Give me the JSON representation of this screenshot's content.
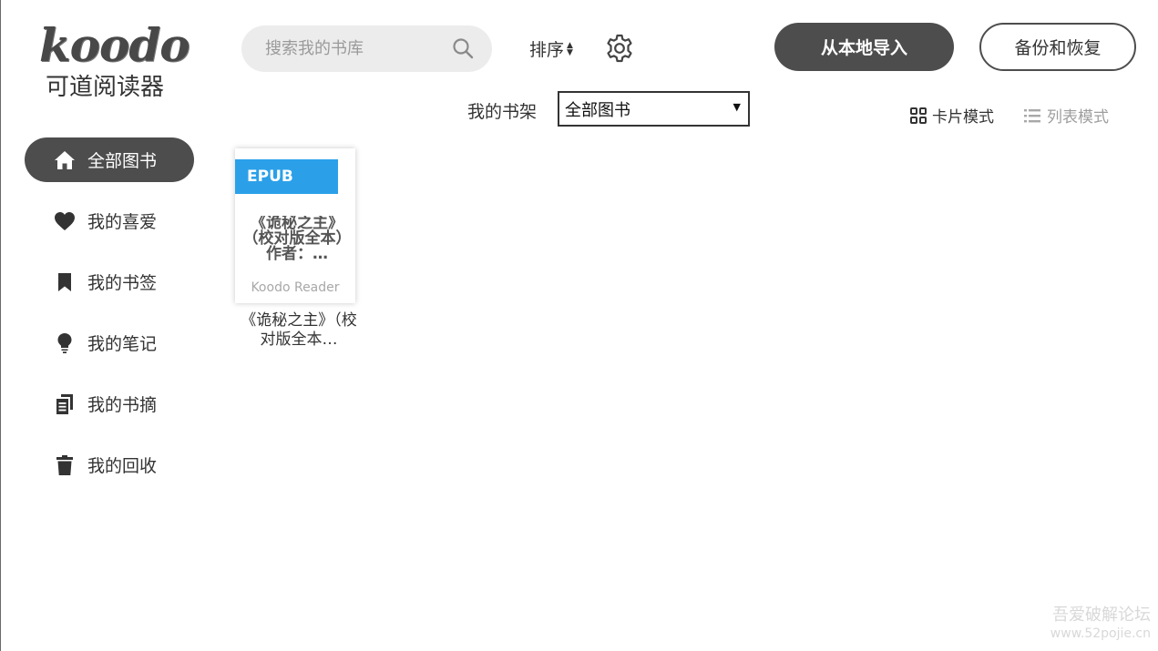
{
  "logo": {
    "wordmark": "koodo",
    "subtitle": "可道阅读器"
  },
  "sidebar": {
    "items": [
      {
        "label": "全部图书",
        "icon": "home-icon",
        "active": true
      },
      {
        "label": "我的喜爱",
        "icon": "heart-icon"
      },
      {
        "label": "我的书签",
        "icon": "bookmark-icon"
      },
      {
        "label": "我的笔记",
        "icon": "lightbulb-icon"
      },
      {
        "label": "我的书摘",
        "icon": "copy-icon"
      },
      {
        "label": "我的回收",
        "icon": "trash-icon"
      }
    ]
  },
  "header": {
    "search_placeholder": "搜索我的书库",
    "sort_label": "排序",
    "import_button": "从本地导入",
    "backup_button": "备份和恢复"
  },
  "shelf": {
    "label": "我的书架",
    "selected": "全部图书"
  },
  "view_modes": {
    "card": "卡片模式",
    "list": "列表模式",
    "active": "card"
  },
  "books": [
    {
      "format": "EPUB",
      "cover_title": "《诡秘之主》（校对版全本）作者：…",
      "cover_brand": "Koodo Reader",
      "caption": "《诡秘之主》（校对版全本…"
    }
  ],
  "watermark": {
    "line1": "吾爱破解论坛",
    "line2": "www.52pojie.cn"
  },
  "colors": {
    "accent_dark": "#4d4d4d",
    "format_badge": "#2ba0e9",
    "inactive_text": "#9e9e9e"
  }
}
